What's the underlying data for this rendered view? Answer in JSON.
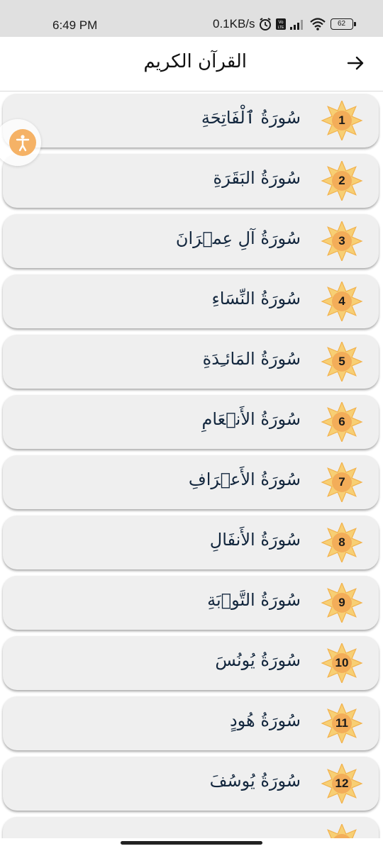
{
  "status_bar": {
    "time": "6:49 PM",
    "network_speed": "0.1KB/s",
    "battery_level": "62",
    "icons": [
      "alarm-icon",
      "volte-icon",
      "signal-icon",
      "wifi-icon",
      "battery-icon"
    ]
  },
  "app_bar": {
    "title": "القرآن الكريم",
    "back_icon": "arrow-right-icon"
  },
  "colors": {
    "row_bg": "#efefef",
    "badge_outer": "#f7cf74",
    "badge_inner": "#f3ad59",
    "title_text": "#12263d",
    "accessibility": "#f5b266"
  },
  "surahs": [
    {
      "number": "1",
      "name": "سُورَةُ ٱلْفَاتِحَةِ"
    },
    {
      "number": "2",
      "name": "سُورَةُ البَقَرَةِ"
    },
    {
      "number": "3",
      "name": "سُورَةُ آلِ عِمۡرَانَ"
    },
    {
      "number": "4",
      "name": "سُورَةُ النِّسَاءِ"
    },
    {
      "number": "5",
      "name": "سُورَةُ المَائـِدَةِ"
    },
    {
      "number": "6",
      "name": "سُورَةُ الأَنۡعَامِ"
    },
    {
      "number": "7",
      "name": "سُورَةُ الأَعۡرَافِ"
    },
    {
      "number": "8",
      "name": "سُورَةُ الأَنفَالِ"
    },
    {
      "number": "9",
      "name": "سُورَةُ التَّوۡبَةِ"
    },
    {
      "number": "10",
      "name": "سُورَةُ يُونُسَ"
    },
    {
      "number": "11",
      "name": "سُورَةُ هُودٍ"
    },
    {
      "number": "12",
      "name": "سُورَةُ يُوسُفَ"
    },
    {
      "number": "",
      "name": ""
    }
  ],
  "accessibility_button": {
    "icon": "accessibility-person-icon"
  }
}
